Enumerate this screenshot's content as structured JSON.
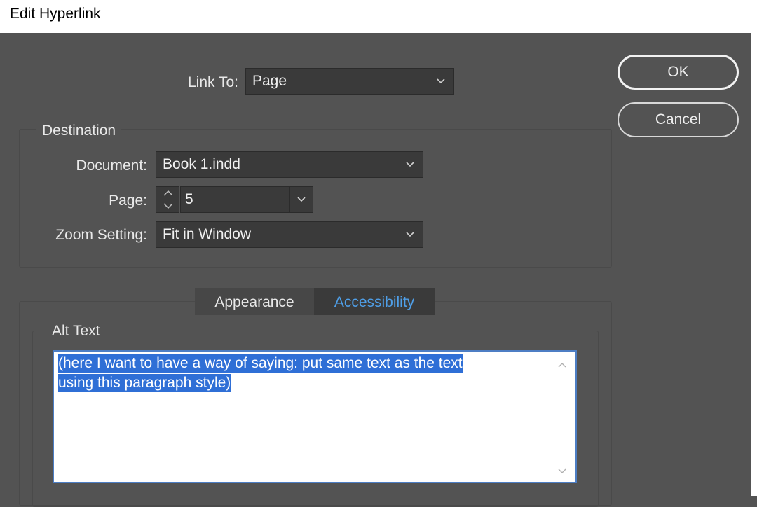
{
  "window": {
    "title": "Edit Hyperlink"
  },
  "link_to": {
    "label": "Link To:",
    "value": "Page"
  },
  "buttons": {
    "ok": "OK",
    "cancel": "Cancel"
  },
  "destination": {
    "title": "Destination",
    "document": {
      "label": "Document:",
      "value": "Book 1.indd"
    },
    "page": {
      "label": "Page:",
      "value": "5"
    },
    "zoom": {
      "label": "Zoom Setting:",
      "value": "Fit in Window"
    }
  },
  "tabs": [
    {
      "label": "Appearance",
      "active": false
    },
    {
      "label": "Accessibility",
      "active": true
    }
  ],
  "alt_text": {
    "title": "Alt Text",
    "lines": [
      "(here I want to have a way of saying: put same text as the text",
      "using this paragraph style)"
    ]
  },
  "colors": {
    "background": "#535353",
    "accent": "#4f9fe8",
    "selection": "#2f6fd6"
  },
  "icons": [
    "chevron-down-icon",
    "stepper-up-icon",
    "stepper-down-icon",
    "scroll-up-icon",
    "scroll-down-icon"
  ]
}
